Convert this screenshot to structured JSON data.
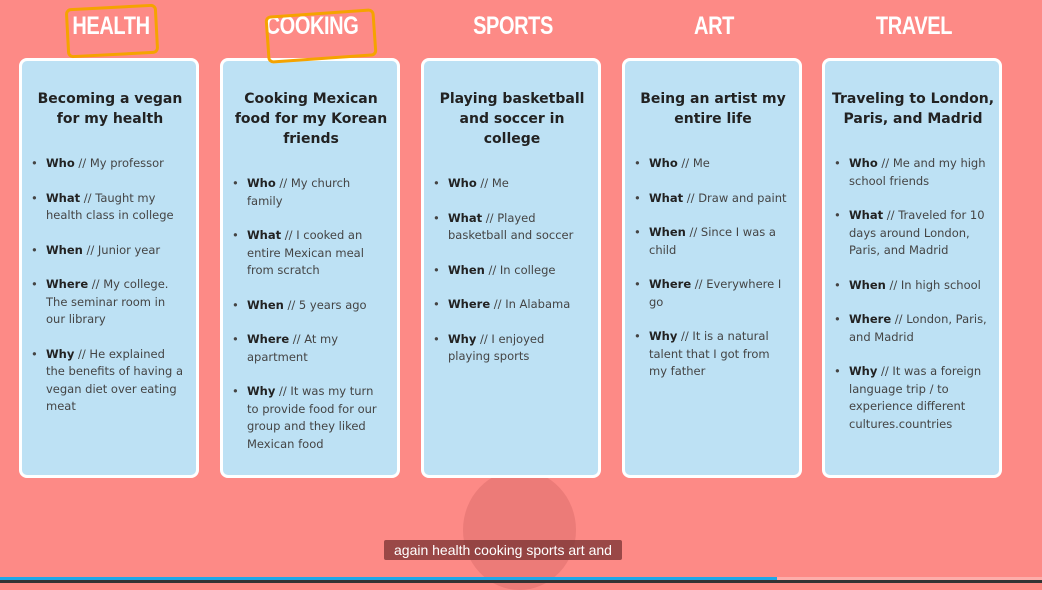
{
  "categories": [
    {
      "title": "HEALTH",
      "heading": "Becoming a vegan for my health",
      "items": [
        {
          "k": "Who",
          "v": " // My professor"
        },
        {
          "k": "What",
          "v": " // Taught my health class in college"
        },
        {
          "k": "When",
          "v": " // Junior year"
        },
        {
          "k": "Where",
          "v": " // My college. The seminar room in our library"
        },
        {
          "k": "Why",
          "v": " // He explained the benefits of having a vegan diet over eating meat"
        }
      ]
    },
    {
      "title": "COOKING",
      "heading": "Cooking Mexican food for my Korean friends",
      "items": [
        {
          "k": "Who",
          "v": " // My church family"
        },
        {
          "k": "What",
          "v": " // I cooked an entire Mexican meal from scratch"
        },
        {
          "k": "When",
          "v": " // 5 years ago"
        },
        {
          "k": "Where",
          "v": " // At my apartment"
        },
        {
          "k": "Why",
          "v": " // It was my turn to provide food for our group and they liked Mexican food"
        }
      ]
    },
    {
      "title": "SPORTS",
      "heading": "Playing basketball and soccer in college",
      "items": [
        {
          "k": "Who",
          "v": " // Me"
        },
        {
          "k": "What",
          "v": " // Played basketball and soccer"
        },
        {
          "k": "When",
          "v": " // In college"
        },
        {
          "k": "Where",
          "v": " // In Alabama"
        },
        {
          "k": "Why",
          "v": " // I enjoyed playing sports"
        }
      ]
    },
    {
      "title": "ART",
      "heading": "Being an artist my entire life",
      "items": [
        {
          "k": "Who",
          "v": " // Me"
        },
        {
          "k": "What",
          "v": " // Draw and paint"
        },
        {
          "k": "When",
          "v": " // Since I was a child"
        },
        {
          "k": "Where",
          "v": " // Everywhere I go"
        },
        {
          "k": "Why",
          "v": " // It is a natural talent that I got from my father"
        }
      ]
    },
    {
      "title": "TRAVEL",
      "heading": "Traveling to London, Paris, and Madrid",
      "items": [
        {
          "k": "Who",
          "v": " // Me and my high school friends"
        },
        {
          "k": "What",
          "v": " // Traveled for 10 days around London, Paris, and Madrid"
        },
        {
          "k": "When",
          "v": " // In high school"
        },
        {
          "k": "Where",
          "v": " // London, Paris, and Madrid"
        },
        {
          "k": "Why",
          "v": " // It was a foreign language trip / to experience different cultures.countries"
        }
      ]
    }
  ],
  "caption": "again health cooking sports art and",
  "video_progress_percent": 74.6,
  "colors": {
    "background": "#fd8a86",
    "card": "#bde1f4",
    "highlight": "#f5a300",
    "progress": "#1ea7e8"
  }
}
